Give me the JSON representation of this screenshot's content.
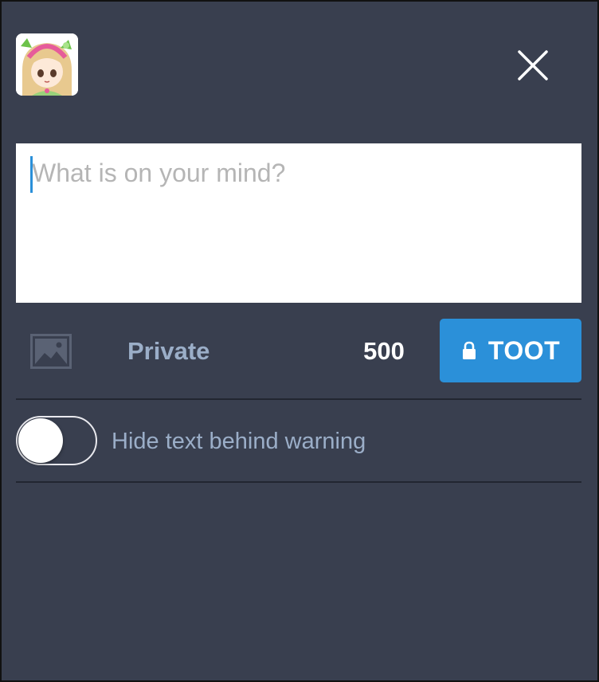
{
  "header": {
    "avatar_icon": "user-avatar-anime-girl",
    "close_icon": "close-icon"
  },
  "compose": {
    "placeholder": "What is on your mind?",
    "value": ""
  },
  "toolbar": {
    "media_icon": "image-icon",
    "privacy_label": "Private",
    "char_count": "500",
    "toot_label": "TOOT",
    "toot_icon": "lock-icon"
  },
  "content_warning": {
    "enabled": false,
    "label": "Hide text behind warning"
  },
  "colors": {
    "background": "#393f4f",
    "accent": "#2b90d9",
    "muted_text": "#9baec8",
    "divider": "#222631"
  }
}
